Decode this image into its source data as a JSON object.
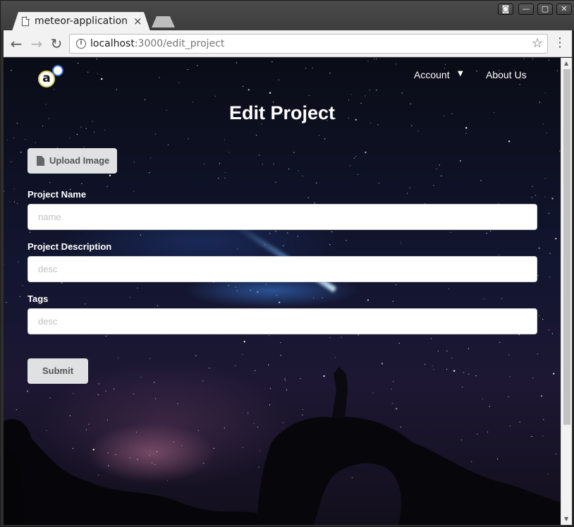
{
  "browser": {
    "tab_title": "meteor-application",
    "tab_close": "×",
    "url_host": "localhost",
    "url_path": ":3000/edit_project",
    "window_controls": {
      "profile": "◙",
      "minimize": "—",
      "maximize": "▢",
      "close": "✕"
    },
    "icons": [
      "back-arrow-icon",
      "forward-arrow-icon",
      "reload-icon",
      "info-icon",
      "bookmark-star-icon",
      "menu-dots-icon"
    ]
  },
  "nav": {
    "logo_letter": "a",
    "account_label": "Account",
    "about_label": "About Us"
  },
  "page": {
    "title": "Edit Project",
    "upload_button": "Upload Image",
    "fields": [
      {
        "label": "Project Name",
        "placeholder": "name",
        "value": ""
      },
      {
        "label": "Project Description",
        "placeholder": "desc",
        "value": ""
      },
      {
        "label": "Tags",
        "placeholder": "desc",
        "value": ""
      }
    ],
    "submit_button": "Submit"
  },
  "colors": {
    "button_bg": "#e0e1e2",
    "button_text": "#555555",
    "label_text": "#ffffff",
    "input_border": "#d4d4d5"
  }
}
